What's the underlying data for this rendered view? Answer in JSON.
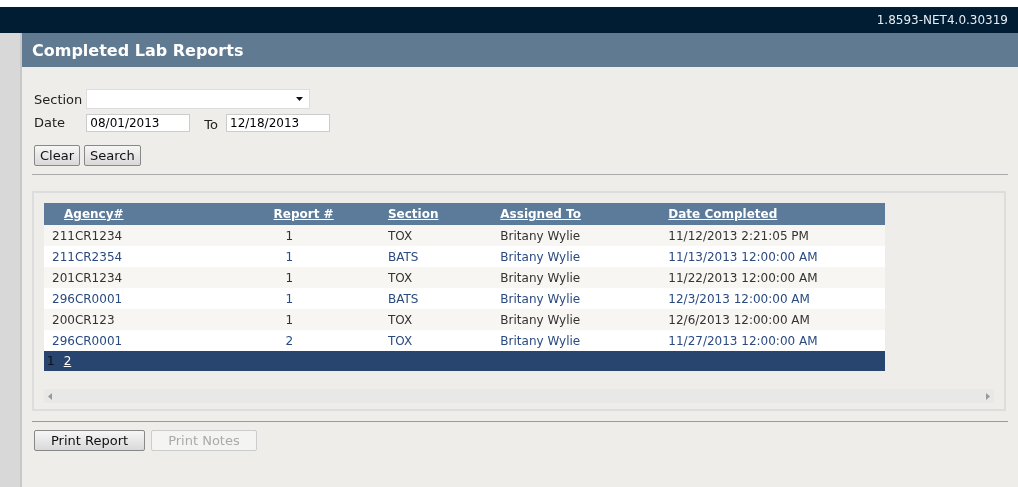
{
  "top_bar": {
    "version": "1.8593-NET4.0.30319"
  },
  "panel": {
    "title": "Completed Lab Reports"
  },
  "filters": {
    "section": {
      "label": "Section"
    },
    "date": {
      "label": "Date",
      "value": "08/01/2013"
    },
    "to": {
      "label": "To",
      "value": "12/18/2013"
    }
  },
  "filter_buttons": [
    {
      "label": "Clear",
      "disabled": false
    },
    {
      "label": "Search",
      "disabled": false
    }
  ],
  "table": {
    "columns": [
      "Agency#",
      "Report #",
      "Section",
      "Assigned To",
      "Date Completed"
    ],
    "rows": [
      [
        "211CR1234",
        "1",
        "TOX",
        "Britany Wylie",
        "11/12/2013 2:21:05 PM"
      ],
      [
        "211CR2354",
        "1",
        "BATS",
        "Britany Wylie",
        "11/13/2013 12:00:00 AM"
      ],
      [
        "201CR1234",
        "1",
        "TOX",
        "Britany Wylie",
        "11/22/2013 12:00:00 AM"
      ],
      [
        "296CR0001",
        "1",
        "BATS",
        "Britany Wylie",
        "12/3/2013 12:00:00 AM"
      ],
      [
        "200CR123",
        "1",
        "TOX",
        "Britany Wylie",
        "12/6/2013 12:00:00 AM"
      ],
      [
        "296CR0001",
        "2",
        "TOX",
        "Britany Wylie",
        "11/27/2013 12:00:00 AM"
      ]
    ],
    "pages": [
      {
        "label": "1",
        "selected": true
      },
      {
        "label": "2",
        "selected": false
      }
    ]
  },
  "bottom_buttons": [
    {
      "label": "Print Report",
      "disabled": false
    },
    {
      "label": "Print Notes",
      "disabled": true
    }
  ]
}
